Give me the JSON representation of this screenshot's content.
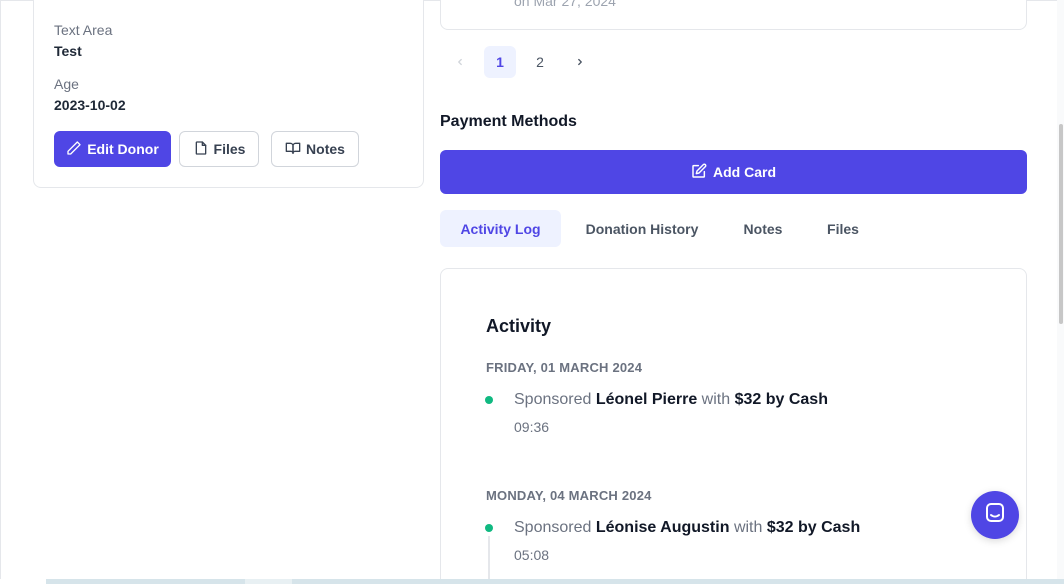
{
  "donor": {
    "fields": [
      {
        "label": "Text Area",
        "value": "Test"
      },
      {
        "label": "Age",
        "value": "2023-10-02"
      }
    ],
    "actions": {
      "edit_label": "Edit Donor",
      "files_label": "Files",
      "notes_label": "Notes"
    }
  },
  "top_card": {
    "cut_text": "on Mar 27, 2024"
  },
  "pagination": {
    "pages": [
      "1",
      "2"
    ],
    "current": "1",
    "prev_icon": "chevron-left-icon",
    "next_icon": "chevron-right-icon"
  },
  "payment": {
    "title": "Payment Methods",
    "add_card_label": "Add Card"
  },
  "tabs": [
    {
      "label": "Activity Log",
      "active": true
    },
    {
      "label": "Donation History",
      "active": false
    },
    {
      "label": "Notes",
      "active": false
    },
    {
      "label": "Files",
      "active": false
    }
  ],
  "activity": {
    "title": "Activity",
    "groups": [
      {
        "date": "FRIDAY, 01 MARCH 2024",
        "verb": "Sponsored",
        "name": "Léonel Pierre",
        "with": "with",
        "amount": "$32 by Cash",
        "time": "09:36"
      },
      {
        "date": "MONDAY, 04 MARCH 2024",
        "verb": "Sponsored",
        "name": "Léonise Augustin",
        "with": "with",
        "amount": "$32 by Cash",
        "time": "05:08"
      }
    ]
  },
  "colors": {
    "primary": "#4f46e5",
    "primary_light": "#eef2ff",
    "success": "#10b981"
  },
  "chat": {
    "icon": "chat-bubble-icon"
  }
}
